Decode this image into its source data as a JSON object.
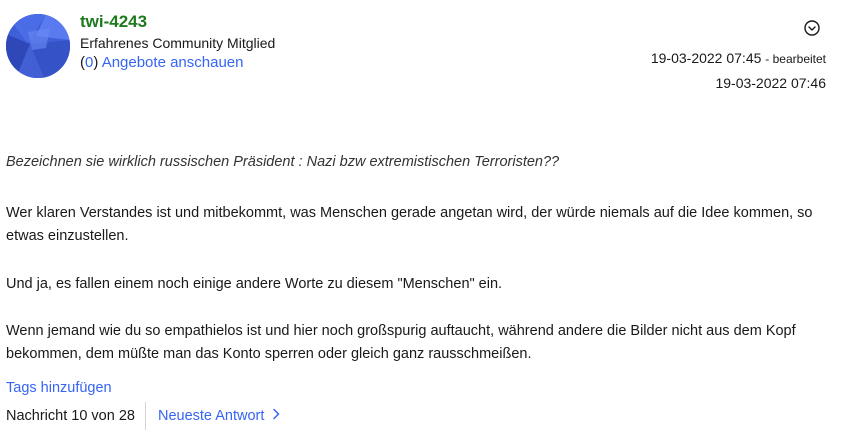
{
  "author": {
    "username": "twi-4243",
    "rank": "Erfahrenes Community Mitglied",
    "offers_open": "(",
    "offers_count": "0",
    "offers_close": ")",
    "offers_link": "Angebote anschauen",
    "avatar_color": "#3d5cd6"
  },
  "meta": {
    "edited_date": "19-03-2022 07:45",
    "edited_label": "- bearbeitet",
    "posted_date": "19-03-2022 07:46",
    "options_icon": "chevron-down-circle"
  },
  "body": {
    "quote": "Bezeichnen sie wirklich russischen Präsident : Nazi bzw extremistischen Terroristen??",
    "paragraph1": "Wer klaren Verstandes ist und mitbekommt, was Menschen gerade angetan wird, der würde niemals auf die Idee kommen, so etwas einzustellen.",
    "paragraph2": "Und ja, es fallen einem noch einige andere Worte zu diesem \"Menschen\" ein.",
    "paragraph3": "Wenn jemand wie du so empathielos ist und hier noch großspurig auftaucht, während andere die Bilder  nicht aus dem Kopf bekommen, dem müßte man das Konto sperren oder gleich ganz rausschmeißen."
  },
  "footer": {
    "tags_link": "Tags hinzufügen",
    "message_counter": "Nachricht 10 von 28",
    "latest_reply": "Neueste Antwort"
  },
  "colors": {
    "link": "#3665f3",
    "username": "#1f7a1f"
  }
}
